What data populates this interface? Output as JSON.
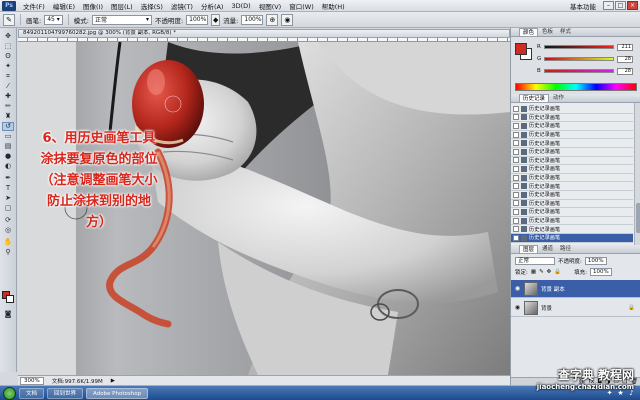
{
  "menubar": {
    "logo": "Ps",
    "items": [
      "文件(F)",
      "编辑(E)",
      "图像(I)",
      "图层(L)",
      "选择(S)",
      "滤镜(T)",
      "分析(A)",
      "3D(D)",
      "视图(V)",
      "窗口(W)",
      "帮助(H)"
    ],
    "workspace": "基本功能",
    "win_min": "–",
    "win_max": "□",
    "win_close": "×"
  },
  "options": {
    "brush_label": "画笔:",
    "brush_size": "45",
    "mode_label": "模式:",
    "mode_value": "正常",
    "opacity_label": "不透明度:",
    "opacity_value": "100%",
    "flow_label": "流量:",
    "flow_value": "100%"
  },
  "document": {
    "tab_title": "849201104799760282.jpg @ 300% (背景 副本, RGB/8) *"
  },
  "instruction_text": "6、用历史画笔工具涂抹要复原色的部位（注意调整画笔大小防止涂抹到别的地方）",
  "status": {
    "zoom": "300%",
    "doc_info": "文档:997.6K/1.99M"
  },
  "panels": {
    "color_tabs": [
      "颜色",
      "色板",
      "样式"
    ],
    "color": {
      "r_label": "R",
      "r_value": "211",
      "g_label": "G",
      "g_value": "28",
      "b_label": "B",
      "b_value": "28"
    },
    "history_tabs": [
      "历史记录",
      "动作"
    ],
    "history_items": [
      "历史记录画笔",
      "历史记录画笔",
      "历史记录画笔",
      "历史记录画笔",
      "历史记录画笔",
      "历史记录画笔",
      "历史记录画笔",
      "历史记录画笔",
      "历史记录画笔",
      "历史记录画笔",
      "历史记录画笔",
      "历史记录画笔",
      "历史记录画笔",
      "历史记录画笔",
      "历史记录画笔",
      "历史记录画笔"
    ],
    "layers_tabs": [
      "图层",
      "通道",
      "路径"
    ],
    "layers": {
      "blend_mode": "正常",
      "opacity_label": "不透明度:",
      "opacity_value": "100%",
      "lock_label": "锁定:",
      "fill_label": "填充:",
      "fill_value": "100%",
      "items": [
        "背景 副本",
        "背景"
      ]
    }
  },
  "taskbar": {
    "items": [
      "文档",
      "回到世界",
      "Adobe Photoshop"
    ]
  },
  "watermark": {
    "main": "查字典 教程网",
    "url": "jiaocheng.chazidian.com"
  },
  "colors": {
    "accent_red": "#d7261c",
    "selection_blue": "#3a5ea8",
    "foreground": "#cc2c22"
  }
}
